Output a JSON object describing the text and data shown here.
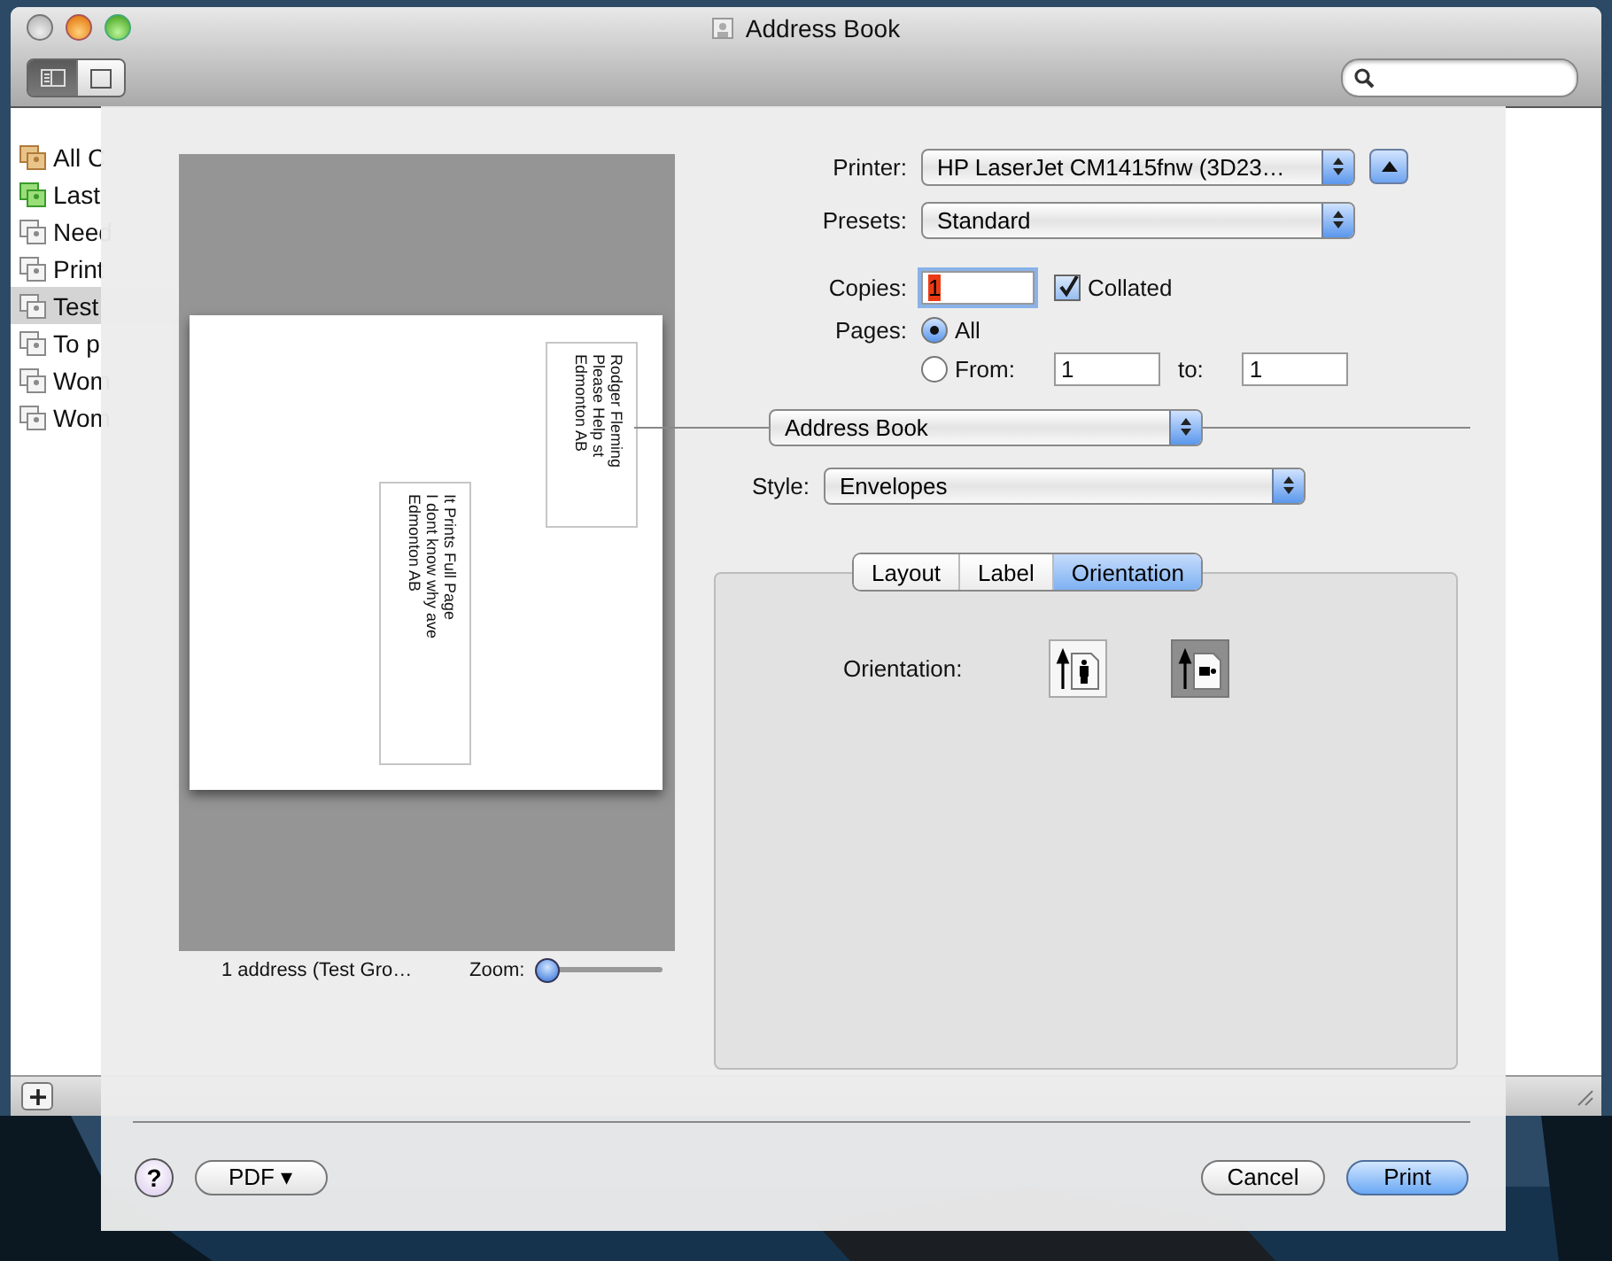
{
  "window": {
    "title": "Address Book"
  },
  "view_buttons": [
    {
      "kind": "list",
      "selected": true
    },
    {
      "kind": "card",
      "selected": false
    }
  ],
  "sidebar": {
    "items": [
      {
        "label": "All C",
        "kind": "all",
        "selected": false
      },
      {
        "label": "Last",
        "kind": "smart",
        "selected": false
      },
      {
        "label": "Need",
        "kind": "group",
        "selected": false
      },
      {
        "label": "Print",
        "kind": "group",
        "selected": false
      },
      {
        "label": "Test",
        "kind": "group",
        "selected": true
      },
      {
        "label": "To p",
        "kind": "group",
        "selected": false
      },
      {
        "label": "Wom",
        "kind": "group",
        "selected": false
      },
      {
        "label": "Wom",
        "kind": "group",
        "selected": false
      }
    ]
  },
  "print_sheet": {
    "preview": {
      "labels": [
        {
          "lines": [
            "Rodger Fleming",
            "Please Help st",
            "Edmonton  AB"
          ]
        },
        {
          "lines": [
            "It Prints Full Page",
            "I dont know why ave",
            "Edmonton  AB"
          ]
        }
      ],
      "caption": "1 address (Test Gro…",
      "zoom_label": "Zoom:",
      "zoom": {
        "level": 0
      }
    },
    "printer": {
      "label": "Printer:",
      "value": "HP LaserJet CM1415fnw (3D23…"
    },
    "presets": {
      "label": "Presets:",
      "value": "Standard"
    },
    "copies": {
      "label": "Copies:",
      "value": "1",
      "collated_label": "Collated",
      "collated": true
    },
    "pages": {
      "label": "Pages:",
      "options": [
        {
          "label": "All",
          "selected": true
        },
        {
          "label": "From:",
          "selected": false
        }
      ],
      "from": "1",
      "to_label": "to:",
      "to": "1"
    },
    "section": "Address Book",
    "style": {
      "label": "Style:",
      "value": "Envelopes"
    },
    "tabs": [
      {
        "label": "Layout",
        "selected": false
      },
      {
        "label": "Label",
        "selected": false
      },
      {
        "label": "Orientation",
        "selected": true
      }
    ],
    "orientation": {
      "label": "Orientation:",
      "options": [
        {
          "kind": "portrait",
          "selected": false
        },
        {
          "kind": "landscape",
          "selected": true
        }
      ]
    },
    "buttons": {
      "help": "?",
      "pdf": "PDF ▾",
      "cancel": "Cancel",
      "print": "Print"
    }
  }
}
